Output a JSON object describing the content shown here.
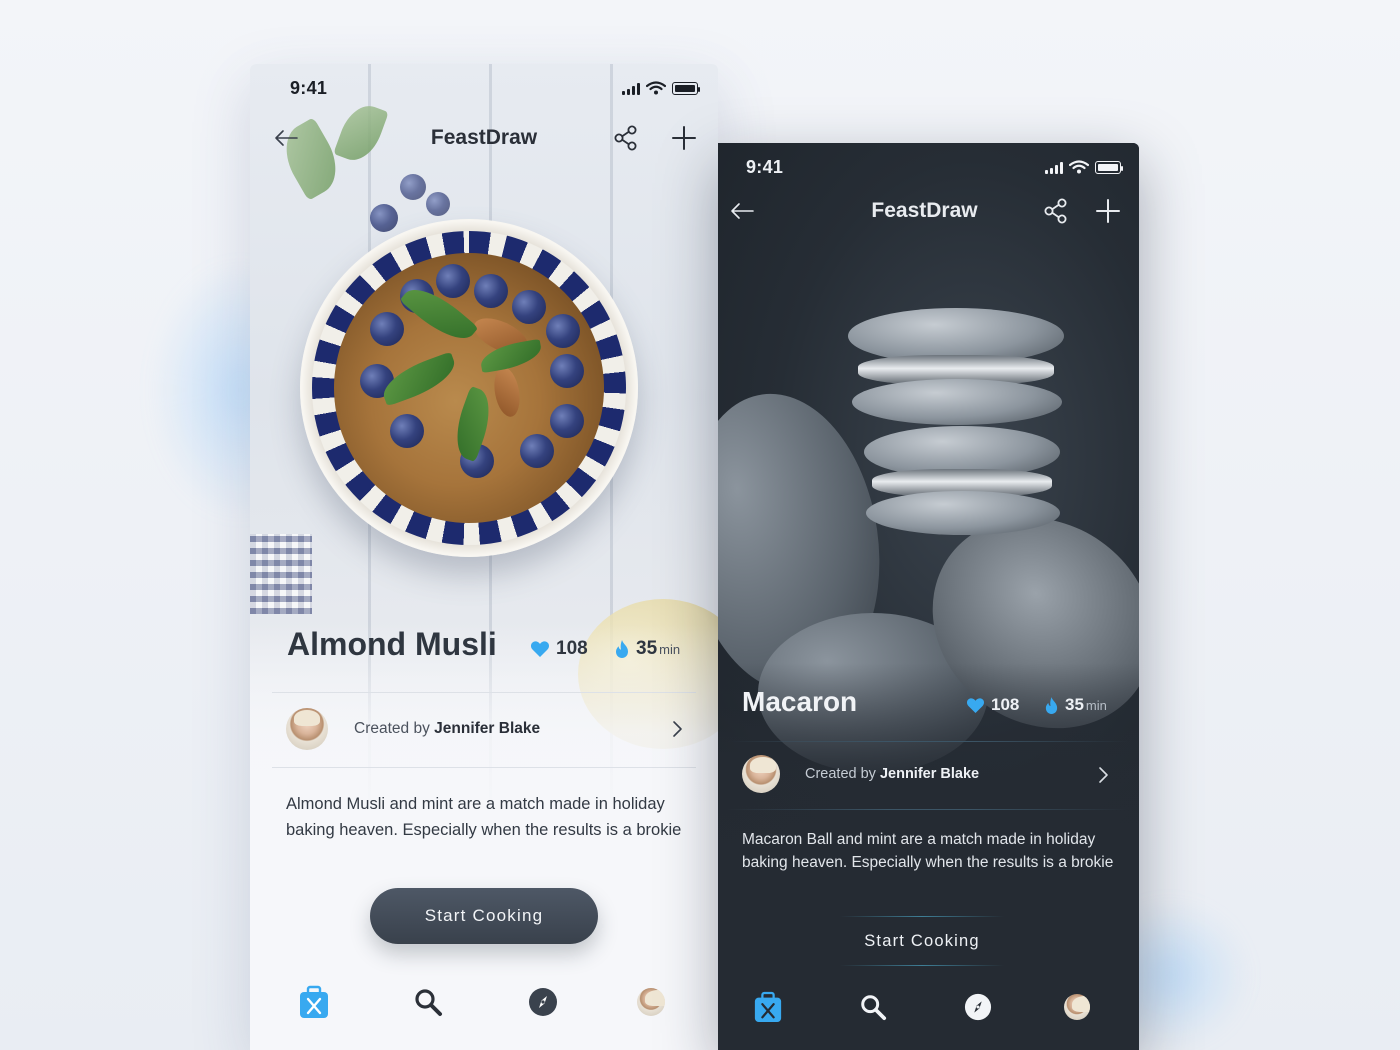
{
  "colors": {
    "accent_blue": "#38a9f0",
    "light_bg": "#f6f7fa",
    "dark_bg": "#252b33",
    "cta_light": "#434c58"
  },
  "light_screen": {
    "status": {
      "time": "9:41"
    },
    "nav": {
      "title": "FeastDraw",
      "back_icon": "arrow-left-icon",
      "share_icon": "share-icon",
      "add_icon": "plus-icon"
    },
    "recipe": {
      "title": "Almond Musli",
      "likes": "108",
      "time_value": "35",
      "time_unit": "min"
    },
    "creator": {
      "prefix": "Created by",
      "name": "Jennifer Blake"
    },
    "description": "Almond Musli and mint are a match made in holiday baking heaven. Especially when the results is a brokie",
    "cta": "Start Cooking",
    "tabs": [
      "home-bag-icon",
      "search-icon",
      "compass-icon",
      "profile-avatar"
    ]
  },
  "dark_screen": {
    "status": {
      "time": "9:41"
    },
    "nav": {
      "title": "FeastDraw",
      "back_icon": "arrow-left-icon",
      "share_icon": "share-icon",
      "add_icon": "plus-icon"
    },
    "recipe": {
      "title": "Macaron",
      "likes": "108",
      "time_value": "35",
      "time_unit": "min"
    },
    "creator": {
      "prefix": "Created by",
      "name": "Jennifer Blake"
    },
    "description": "Macaron Ball and mint are a match made in holiday baking heaven. Especially when the results is a brokie",
    "cta": "Start Cooking",
    "tabs": [
      "home-bag-icon",
      "search-icon",
      "compass-icon",
      "profile-avatar"
    ]
  }
}
